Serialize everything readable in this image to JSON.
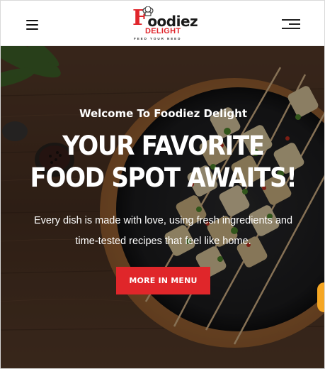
{
  "header": {
    "logo": {
      "brand_initial": "F",
      "brand_rest": "oodiez",
      "subtitle": "DELIGHT",
      "tagline": "FEED YOUR NEED"
    },
    "left_menu_icon": "hamburger-menu-icon",
    "right_menu_icon": "offcanvas-menu-icon"
  },
  "hero": {
    "welcome": "Welcome To Foodiez Delight",
    "headline": "YOUR FAVORITE FOOD SPOT AWAITS!",
    "description": "Every dish is made with love, using fresh ingredients and time-tested recipes that feel like home.",
    "cta_label": "MORE IN MENU"
  },
  "colors": {
    "accent": "#e0262a",
    "side_chip": "#f5a623",
    "text_dark": "#111111"
  }
}
